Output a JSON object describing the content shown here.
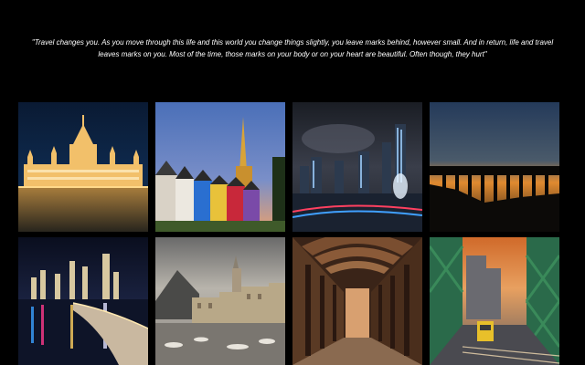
{
  "quote": {
    "text": "\"Travel changes you. As you move through this life and this world you change things slightly, you leave marks behind, however small. And in return, life and travel leaves marks on you. Most of the time, those marks on your body or on your heart are beautiful. Often though, they hurt\""
  },
  "gallery": {
    "photos": [
      {
        "subject": "parliament-at-night"
      },
      {
        "subject": "colorful-houses-church-spire"
      },
      {
        "subject": "city-skyline-night-fountain"
      },
      {
        "subject": "aqueduct-sunset-silhouette"
      },
      {
        "subject": "skyline-over-water-night"
      },
      {
        "subject": "coastal-town-harbor"
      },
      {
        "subject": "arched-colonnade-corridor"
      },
      {
        "subject": "green-bridge-tram-sunset"
      }
    ]
  },
  "colors": {
    "background": "#000000",
    "quote_text": "#ffffff"
  }
}
